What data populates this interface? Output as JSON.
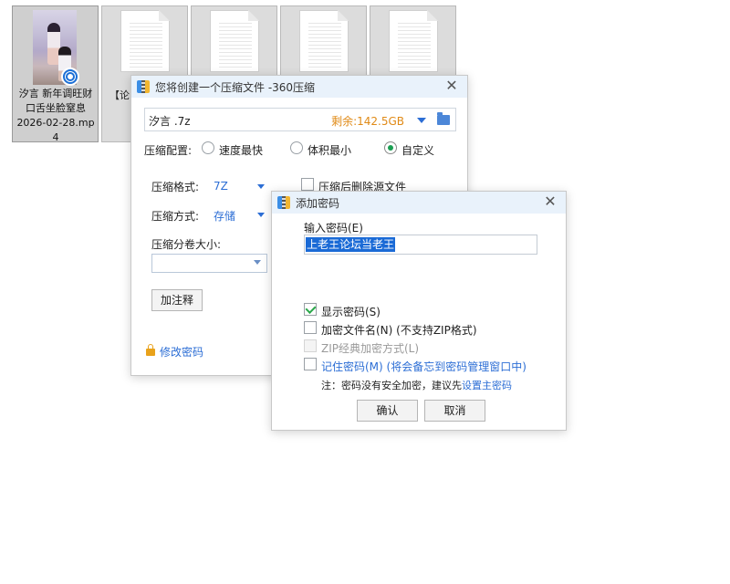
{
  "desktop": {
    "files": [
      {
        "name_line1": "汐言 新年调旺财",
        "name_line2": "口舌坐脸窒息",
        "name_line3": "2026-02-28.mp",
        "name_line4": "4",
        "kind": "video"
      },
      {
        "name": "【论",
        "kind": "document"
      },
      {
        "name": "",
        "kind": "document"
      },
      {
        "name": "",
        "kind": "document"
      },
      {
        "name": "",
        "kind": "document"
      }
    ]
  },
  "compress_dialog": {
    "title": "您将创建一个压缩文件 -360压缩",
    "file_name": "汐言 .7z",
    "free_space": "剩余:142.5GB",
    "config_label": "压缩配置:",
    "options": [
      "速度最快",
      "体积最小",
      "自定义"
    ],
    "selected_option": "自定义",
    "format_label": "压缩格式:",
    "format_value": "7Z",
    "method_label": "压缩方式:",
    "method_value": "存储",
    "volume_label": "压缩分卷大小:",
    "volume_value": "",
    "delete_source_label": "压缩后删除源文件",
    "comment_button": "加注释",
    "change_password_link": "修改密码"
  },
  "password_dialog": {
    "title": "添加密码",
    "input_label": "输入密码(E)",
    "password_value": "上老王论坛当老王",
    "show_password": {
      "label": "显示密码(S)",
      "checked": true
    },
    "encrypt_filenames": {
      "label": "加密文件名(N) (不支持ZIP格式)",
      "checked": false
    },
    "zip_classic": {
      "label": "ZIP经典加密方式(L)",
      "checked": false,
      "disabled": true
    },
    "remember_password": {
      "label": "记住密码(M) (将会备忘到密码管理窗口中)",
      "checked": false
    },
    "note_prefix": "注：密码没有安全加密，建议先",
    "note_link": "设置主密码",
    "ok_button": "确认",
    "cancel_button": "取消"
  },
  "colors": {
    "accent": "#2c6ed5",
    "free_space": "#e08a16",
    "selection": "#1a6ad6",
    "titlebar": "#e9f2fb"
  }
}
